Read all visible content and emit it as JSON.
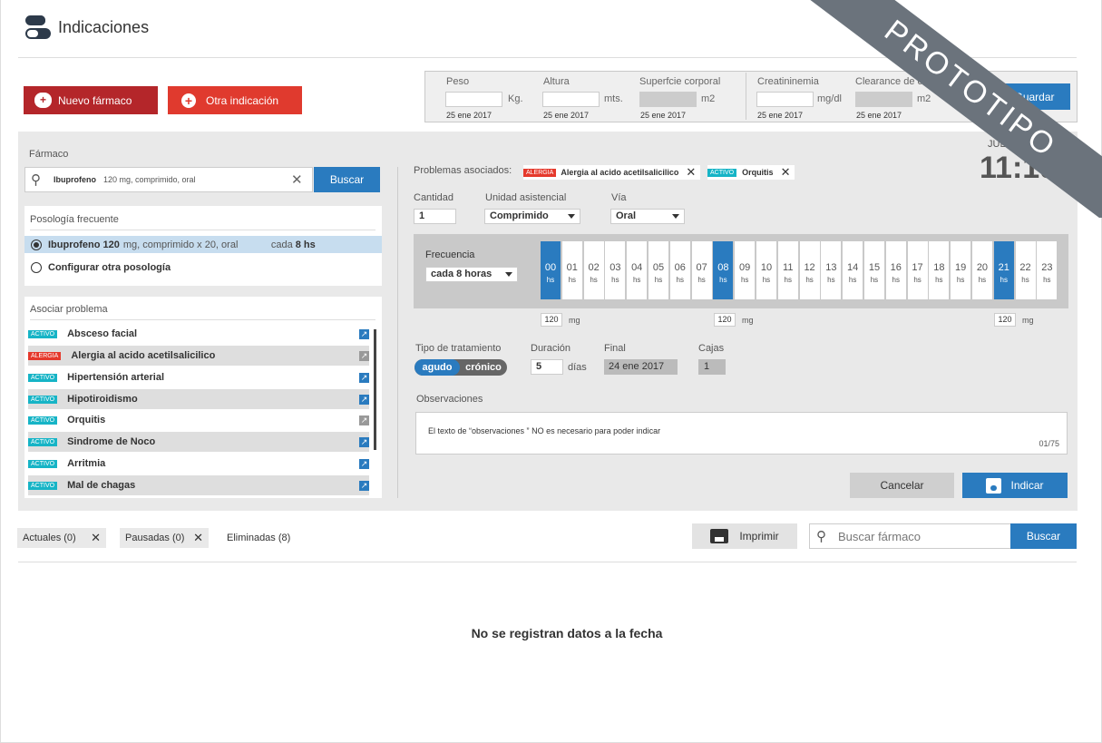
{
  "header": {
    "title": "Indicaciones",
    "watermark": "PROTOTIPO"
  },
  "actions": {
    "new_drug": "Nuevo fármaco",
    "other": "Otra indicación",
    "save": "Guardar"
  },
  "vitals": [
    {
      "label": "Peso",
      "value": "",
      "unit": "Kg.",
      "date": "25 ene 2017"
    },
    {
      "label": "Altura",
      "value": "",
      "unit": "mts.",
      "date": "25 ene 2017"
    },
    {
      "label": "Superfcie corporal",
      "value": "",
      "unit": "m2",
      "date": "25 ene 2017"
    },
    {
      "label": "Creatininemia",
      "value": "",
      "unit": "mg/dl",
      "date": "25 ene 2017"
    },
    {
      "label": "Clearance de creatinina",
      "value": "",
      "unit": "m2",
      "date": "25 ene 2017"
    }
  ],
  "clock": {
    "date": "JUE 19 Ene",
    "time": "11:19"
  },
  "drug": {
    "label": "Fármaco",
    "search_name": "Ibuprofeno",
    "search_detail": "120 mg, comprimido, oral",
    "search_button": "Buscar"
  },
  "posology": {
    "title": "Posología frecuente",
    "option1_name": "Ibuprofeno 120",
    "option1_detail": "mg, comprimido x 20, oral",
    "option1_freq": "cada",
    "option1_freq_val": "8 hs",
    "option2": "Configurar otra posología"
  },
  "problems": {
    "title": "Asociar problema",
    "items": [
      {
        "status": "ACTIVO",
        "name": "Absceso facial"
      },
      {
        "status": "ALERGIA",
        "name": "Alergia al acido acetilsalicilico"
      },
      {
        "status": "ACTIVO",
        "name": "Hipertensión arterial"
      },
      {
        "status": "ACTIVO",
        "name": "Hipotiroidismo"
      },
      {
        "status": "ACTIVO",
        "name": "Orquitis"
      },
      {
        "status": "ACTIVO",
        "name": "Sindrome de Noco"
      },
      {
        "status": "ACTIVO",
        "name": "Arritmia"
      },
      {
        "status": "ACTIVO",
        "name": "Mal de chagas"
      }
    ]
  },
  "associated": {
    "label": "Problemas asociados:",
    "tag1_status": "ALERGIA",
    "tag1_name": "Alergia al acido acetilsalicilico",
    "tag2_status": "ACTIVO",
    "tag2_name": "Orquitis"
  },
  "form": {
    "qty_label": "Cantidad",
    "qty": "1",
    "unit_label": "Unidad asistencial",
    "unit": "Comprimido",
    "route_label": "Vía",
    "route": "Oral",
    "freq_label": "Frecuencia",
    "freq": "cada 8 horas",
    "hours": [
      "00",
      "01",
      "02",
      "03",
      "04",
      "05",
      "06",
      "07",
      "08",
      "09",
      "10",
      "11",
      "12",
      "13",
      "14",
      "15",
      "16",
      "17",
      "18",
      "19",
      "20",
      "21",
      "22",
      "23"
    ],
    "hours_unit": "hs",
    "dose1": "120",
    "dose2": "120",
    "dose3": "120",
    "dose_unit": "mg",
    "type_label": "Tipo de tratamiento",
    "type_a": "agudo",
    "type_b": "crónico",
    "dur_label": "Duración",
    "dur": "5",
    "dur_unit": "días",
    "final_label": "Final",
    "final": "24 ene 2017",
    "boxes_label": "Cajas",
    "boxes": "1",
    "obs_label": "Observaciones",
    "obs_text_1": "El texto de “observaciones ”",
    "obs_text_2": "NO",
    "obs_text_3": "es necesario para poder indicar",
    "obs_count": "01/75",
    "cancel": "Cancelar",
    "submit": "Indicar"
  },
  "bottom": {
    "tab1": "Actuales (0)",
    "tab2": "Pausadas (0)",
    "tab3": "Eliminadas (8)",
    "print": "Imprimir",
    "search_placeholder": "Buscar fármaco",
    "search_button": "Buscar",
    "empty": "No se registran datos a la fecha"
  }
}
